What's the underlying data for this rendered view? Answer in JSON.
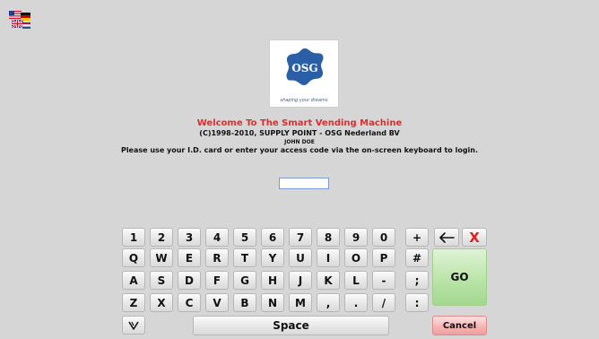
{
  "language_selector": {
    "icon": "flags-icon"
  },
  "logo": {
    "name": "OSG",
    "tagline": "shaping your dreams",
    "color": "#2a5ea7"
  },
  "header": {
    "welcome": "Welcome To The Smart Vending Machine",
    "copyright": "(C)1998-2010, SUPPLY POINT - OSG Nederland BV",
    "username": "JOHN DOE",
    "instructions": "Please use your I.D. card or enter your access code via the on-screen keyboard to login."
  },
  "access_code": {
    "value": ""
  },
  "keyboard": {
    "row1": [
      "1",
      "2",
      "3",
      "4",
      "5",
      "6",
      "7",
      "8",
      "9",
      "0",
      "+"
    ],
    "row2": [
      "Q",
      "W",
      "E",
      "R",
      "T",
      "Y",
      "U",
      "I",
      "O",
      "P",
      "#"
    ],
    "row3": [
      "A",
      "S",
      "D",
      "F",
      "G",
      "H",
      "J",
      "K",
      "L",
      "-",
      ";"
    ],
    "row4": [
      "Z",
      "X",
      "C",
      "V",
      "B",
      "N",
      "M",
      ",",
      ".",
      "/",
      ":"
    ],
    "backspace_icon": "arrow-left-icon",
    "clear_label": "X",
    "go_label": "GO",
    "space_label": "Space",
    "cancel_label": "Cancel",
    "hide_icon": "chevron-down-icon"
  },
  "colors": {
    "background": "#d6d6d6",
    "welcome": "#e32b2b",
    "go": "#b7e3a5",
    "cancel": "#f6b5b5",
    "clear": "#e02020"
  }
}
